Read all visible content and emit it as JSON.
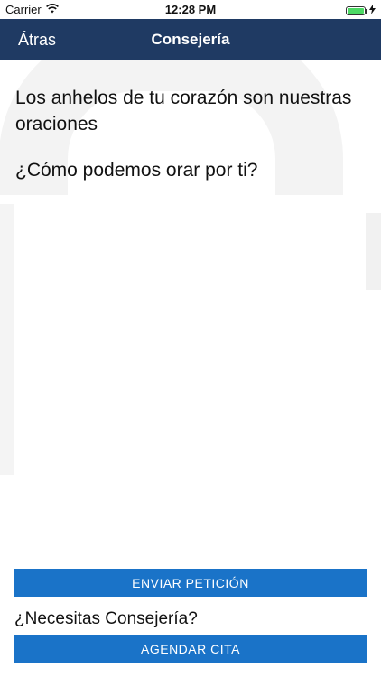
{
  "status_bar": {
    "carrier": "Carrier",
    "time": "12:28 PM",
    "battery_level": 1.0,
    "icons": [
      "wifi-icon",
      "battery-icon",
      "charging-icon"
    ]
  },
  "nav": {
    "back_label": "Átras",
    "title": "Consejería",
    "background_color": "#1f3a63"
  },
  "content": {
    "headline": "Los anhelos de tu corazón son nuestras oraciones",
    "question": "¿Cómo podemos orar por ti?"
  },
  "actions": {
    "send_label": "ENVIAR PETICIÓN",
    "need_counsel_label": "¿Necesitas Consejería?",
    "schedule_label": "AGENDAR CITA",
    "button_color": "#1a73c8"
  }
}
